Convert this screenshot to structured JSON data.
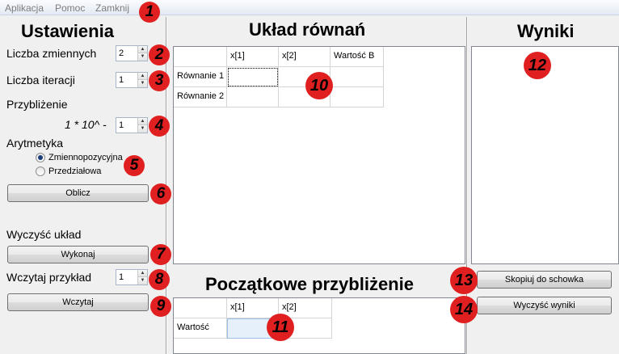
{
  "menu": {
    "items": [
      "Aplikacja",
      "Pomoc",
      "Zamknij"
    ]
  },
  "settings": {
    "title": "Ustawienia",
    "var_count_label": "Liczba zmiennych",
    "var_count_value": "2",
    "iter_count_label": "Liczba iteracji",
    "iter_count_value": "1",
    "approx_label": "Przybliżenie",
    "approx_formula": "1 * 10^ -",
    "approx_value": "1",
    "arith_label": "Arytmetyka",
    "arith_options": [
      "Zmiennopozycyjna",
      "Przedziałowa"
    ],
    "arith_selected": "Zmiennopozycyjna",
    "compute_button": "Oblicz",
    "clear_label": "Wyczyść układ",
    "clear_button": "Wykonaj",
    "load_example_label": "Wczytaj przykład",
    "load_example_value": "1",
    "load_button": "Wczytaj"
  },
  "equations": {
    "title": "Układ równań",
    "columns": [
      "",
      "x[1]",
      "x[2]",
      "Wartość B"
    ],
    "rows": [
      [
        "Równanie 1",
        "",
        "",
        ""
      ],
      [
        "Równanie 2",
        "",
        "",
        ""
      ]
    ]
  },
  "initial": {
    "title": "Początkowe przybliżenie",
    "columns": [
      "",
      "x[1]",
      "x[2]"
    ],
    "rows": [
      [
        "Wartość",
        "",
        ""
      ]
    ]
  },
  "results": {
    "title": "Wyniki",
    "copy_button": "Skopiuj do schowka",
    "clear_button": "Wyczyść wyniki"
  },
  "badges": [
    "1",
    "2",
    "3",
    "4",
    "5",
    "6",
    "7",
    "8",
    "9",
    "10",
    "11",
    "12",
    "13",
    "14"
  ],
  "colors": {
    "badge": "#e02020",
    "menubar": "#e3e9f3",
    "radio_dot": "#1a3c78"
  }
}
